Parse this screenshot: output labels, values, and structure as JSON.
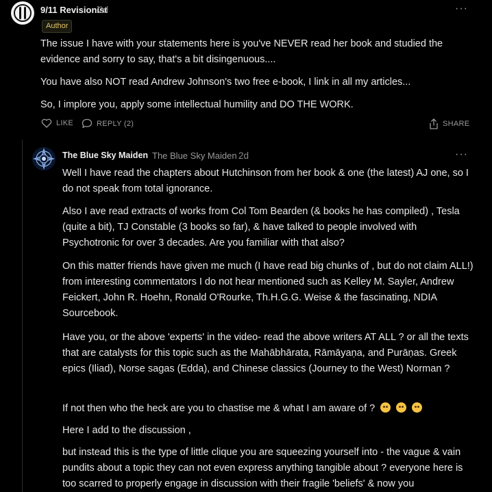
{
  "comment1": {
    "author": "9/11 Revisionist",
    "time": "2d",
    "badge": "Author",
    "more": "···",
    "paragraphs": [
      "The issue I have with your statements here is you've NEVER read her book and studied the evidence and sorry to say, that's a bit disingenuous....",
      "You have also NOT read Andrew Johnson's two free e-book, I link in all my articles...",
      "So, I implore you, apply some intellectual humility and DO THE WORK."
    ],
    "actions": {
      "like": "LIKE",
      "reply": "REPLY (2)",
      "share": "SHARE"
    }
  },
  "comment2": {
    "author": "The Blue Sky Maiden",
    "publication": "The Blue Sky Maiden",
    "time": "2d",
    "more": "···",
    "paragraphs": [
      "Well I have read the chapters about Hutchinson from her book & one (the latest) AJ one, so I do not speak from total ignorance.",
      "Also I ave read extracts of works from Col Tom Bearden (& books he has compiled) , Tesla (quite a bit), TJ Constable (3 books so far), & have talked to people involved with Psychotronic for over 3 decades. Are you familiar with that also?",
      "On this matter friends have given me much (I have read big chunks of , but do not claim ALL!) from interesting commentators I do not hear mentioned such as Kelley M. Sayler, Andrew Feickert, John R. Hoehn, Ronald O'Rourke, Th.H.G.G. Weise & the fascinating, NDIA Sourcebook.",
      "Have you, or the above 'experts' in the video- read the above writers AT ALL ? or all the texts that are catalysts for this topic such as the Mahābhārata, Rāmāyaṇa, and Purāṇas. Greek epics (Iliad), Norse sagas (Edda), and Chinese classics (Journey to the West) Norman ?",
      "If not then who the heck are you to chastise me & what I am aware of ?",
      "Here I add to the discussion ,",
      "but instead this is the type of little clique you are squeezing yourself into - the vague & vain pundits about a topic they can not even express anything tangible about ? everyone here is too scarred to properly engage in discussion with their fragile 'beliefs' & now you"
    ]
  },
  "icons": [
    "avatar-logo",
    "avatar-mandala",
    "heart-icon",
    "comment-icon",
    "share-icon",
    "more-icon",
    "eye-roll-emoji",
    "thinking-emoji",
    "blush-emoji"
  ],
  "colors": {
    "background": "#000000",
    "text": "#e8e8e8",
    "muted": "#8a8a8a",
    "badge": "#e3c468"
  }
}
